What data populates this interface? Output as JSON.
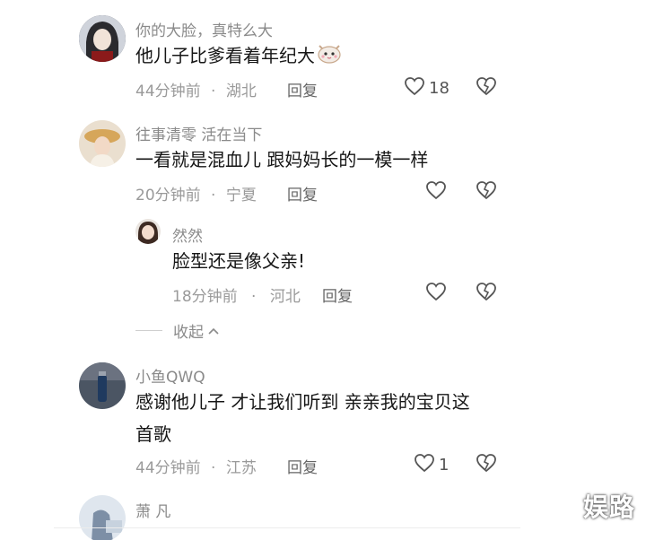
{
  "comments": [
    {
      "username": "你的大脸，真特么大",
      "text": "他儿子比爹看着年纪大",
      "time": "44分钟前",
      "location": "湖北",
      "reply_label": "回复",
      "likes": "18"
    },
    {
      "username": "往事清零 活在当下",
      "text": "一看就是混血儿 跟妈妈长的一模一样",
      "time": "20分钟前",
      "location": "宁夏",
      "reply_label": "回复",
      "likes": ""
    },
    {
      "username": "小鱼QWQ",
      "text_line1": "感谢他儿子 才让我们听到 亲亲我的宝贝这",
      "text_line2": "首歌",
      "time": "44分钟前",
      "location": "江苏",
      "reply_label": "回复",
      "likes": "1"
    },
    {
      "username": "萧 凡"
    }
  ],
  "reply": {
    "username": "然然",
    "text": "脸型还是像父亲!",
    "time": "18分钟前",
    "location": "河北",
    "reply_label": "回复"
  },
  "collapse_label": "收起",
  "separator": "·",
  "watermark": "娱路",
  "colors": {
    "text": "#161616",
    "meta": "#9a9a9a",
    "background": "#ffffff"
  }
}
